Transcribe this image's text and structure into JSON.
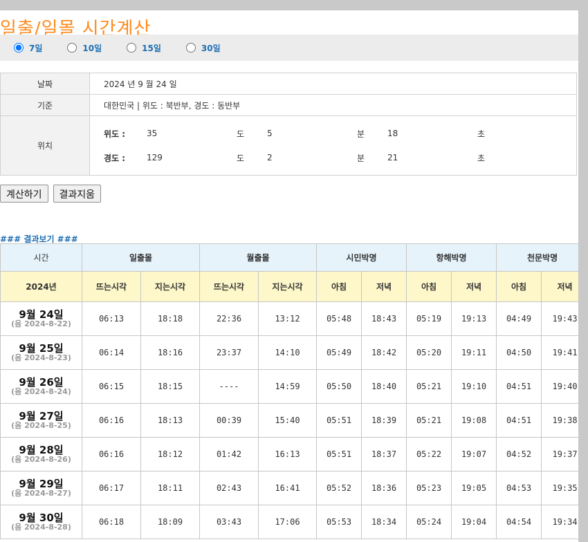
{
  "title": "일출/일몰 시간계산",
  "day_options": [
    {
      "label": "7일",
      "checked": true
    },
    {
      "label": "10일",
      "checked": false
    },
    {
      "label": "15일",
      "checked": false
    },
    {
      "label": "30일",
      "checked": false
    }
  ],
  "info": {
    "date_label": "날짜",
    "date_value": "2024 년 9 월 24 일",
    "basis_label": "기준",
    "basis_value": "대한민국 | 위도 : 북반부, 경도 : 동반부",
    "location_label": "위치",
    "latitude": {
      "label": "위도 :",
      "deg": "35",
      "deg_unit": "도",
      "min": "5",
      "min_unit": "분",
      "sec": "18",
      "sec_unit": "초"
    },
    "longitude": {
      "label": "경도 :",
      "deg": "129",
      "deg_unit": "도",
      "min": "2",
      "min_unit": "분",
      "sec": "21",
      "sec_unit": "초"
    }
  },
  "buttons": {
    "calculate": "계산하기",
    "clear": "결과지움"
  },
  "result": {
    "heading": "### 결과보기 ###",
    "group_headers": [
      "시간",
      "일출몰",
      "월출몰",
      "시민박명",
      "항해박명",
      "천문박명"
    ],
    "sub_headers": [
      "2024년",
      "뜨는시각",
      "지는시각",
      "뜨는시각",
      "지는시각",
      "아침",
      "저녁",
      "아침",
      "저녁",
      "아침",
      "저녁"
    ],
    "rows": [
      {
        "date": "9월 24일",
        "lunar": "(음 2024-8-22)",
        "values": [
          "06:13",
          "18:18",
          "22:36",
          "13:12",
          "05:48",
          "18:43",
          "05:19",
          "19:13",
          "04:49",
          "19:43"
        ]
      },
      {
        "date": "9월 25일",
        "lunar": "(음 2024-8-23)",
        "values": [
          "06:14",
          "18:16",
          "23:37",
          "14:10",
          "05:49",
          "18:42",
          "05:20",
          "19:11",
          "04:50",
          "19:41"
        ]
      },
      {
        "date": "9월 26일",
        "lunar": "(음 2024-8-24)",
        "values": [
          "06:15",
          "18:15",
          "----",
          "14:59",
          "05:50",
          "18:40",
          "05:21",
          "19:10",
          "04:51",
          "19:40"
        ]
      },
      {
        "date": "9월 27일",
        "lunar": "(음 2024-8-25)",
        "values": [
          "06:16",
          "18:13",
          "00:39",
          "15:40",
          "05:51",
          "18:39",
          "05:21",
          "19:08",
          "04:51",
          "19:38"
        ]
      },
      {
        "date": "9월 28일",
        "lunar": "(음 2024-8-26)",
        "values": [
          "06:16",
          "18:12",
          "01:42",
          "16:13",
          "05:51",
          "18:37",
          "05:22",
          "19:07",
          "04:52",
          "19:37"
        ]
      },
      {
        "date": "9월 29일",
        "lunar": "(음 2024-8-27)",
        "values": [
          "06:17",
          "18:11",
          "02:43",
          "16:41",
          "05:52",
          "18:36",
          "05:23",
          "19:05",
          "04:53",
          "19:35"
        ]
      },
      {
        "date": "9월 30일",
        "lunar": "(음 2024-8-28)",
        "values": [
          "06:18",
          "18:09",
          "03:43",
          "17:06",
          "05:53",
          "18:34",
          "05:24",
          "19:04",
          "04:54",
          "19:34"
        ]
      }
    ]
  }
}
